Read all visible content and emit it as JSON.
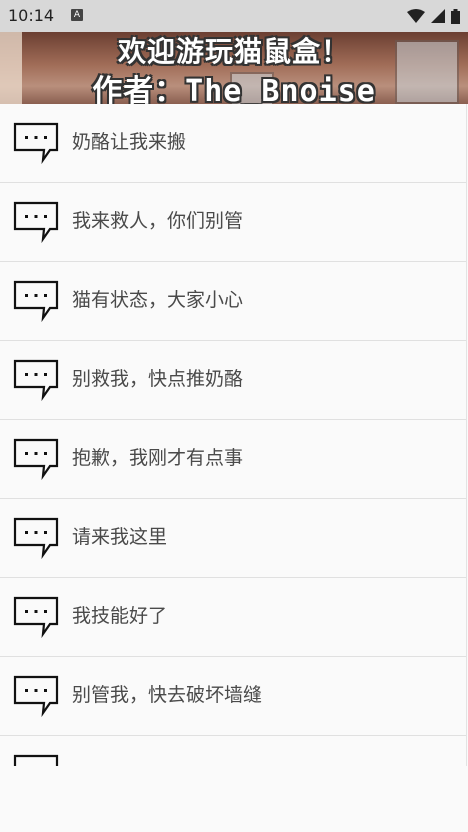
{
  "status_bar": {
    "time": "10:14",
    "notification_badge": "A"
  },
  "banner": {
    "line1": "欢迎游玩猫鼠盒！",
    "line2": "作者：The_Bnoise"
  },
  "list_items": [
    {
      "label": "奶酪让我来搬",
      "icon": "chat-bubble-icon"
    },
    {
      "label": "我来救人，你们别管",
      "icon": "chat-bubble-icon"
    },
    {
      "label": "猫有状态，大家小心",
      "icon": "chat-bubble-icon"
    },
    {
      "label": "别救我，快点推奶酪",
      "icon": "chat-bubble-icon"
    },
    {
      "label": "抱歉，我刚才有点事",
      "icon": "chat-bubble-icon"
    },
    {
      "label": "请来我这里",
      "icon": "chat-bubble-icon"
    },
    {
      "label": "我技能好了",
      "icon": "chat-bubble-icon"
    },
    {
      "label": "别管我，快去破坏墙缝",
      "icon": "chat-bubble-icon"
    },
    {
      "label": "",
      "icon": "chat-bubble-icon"
    }
  ]
}
